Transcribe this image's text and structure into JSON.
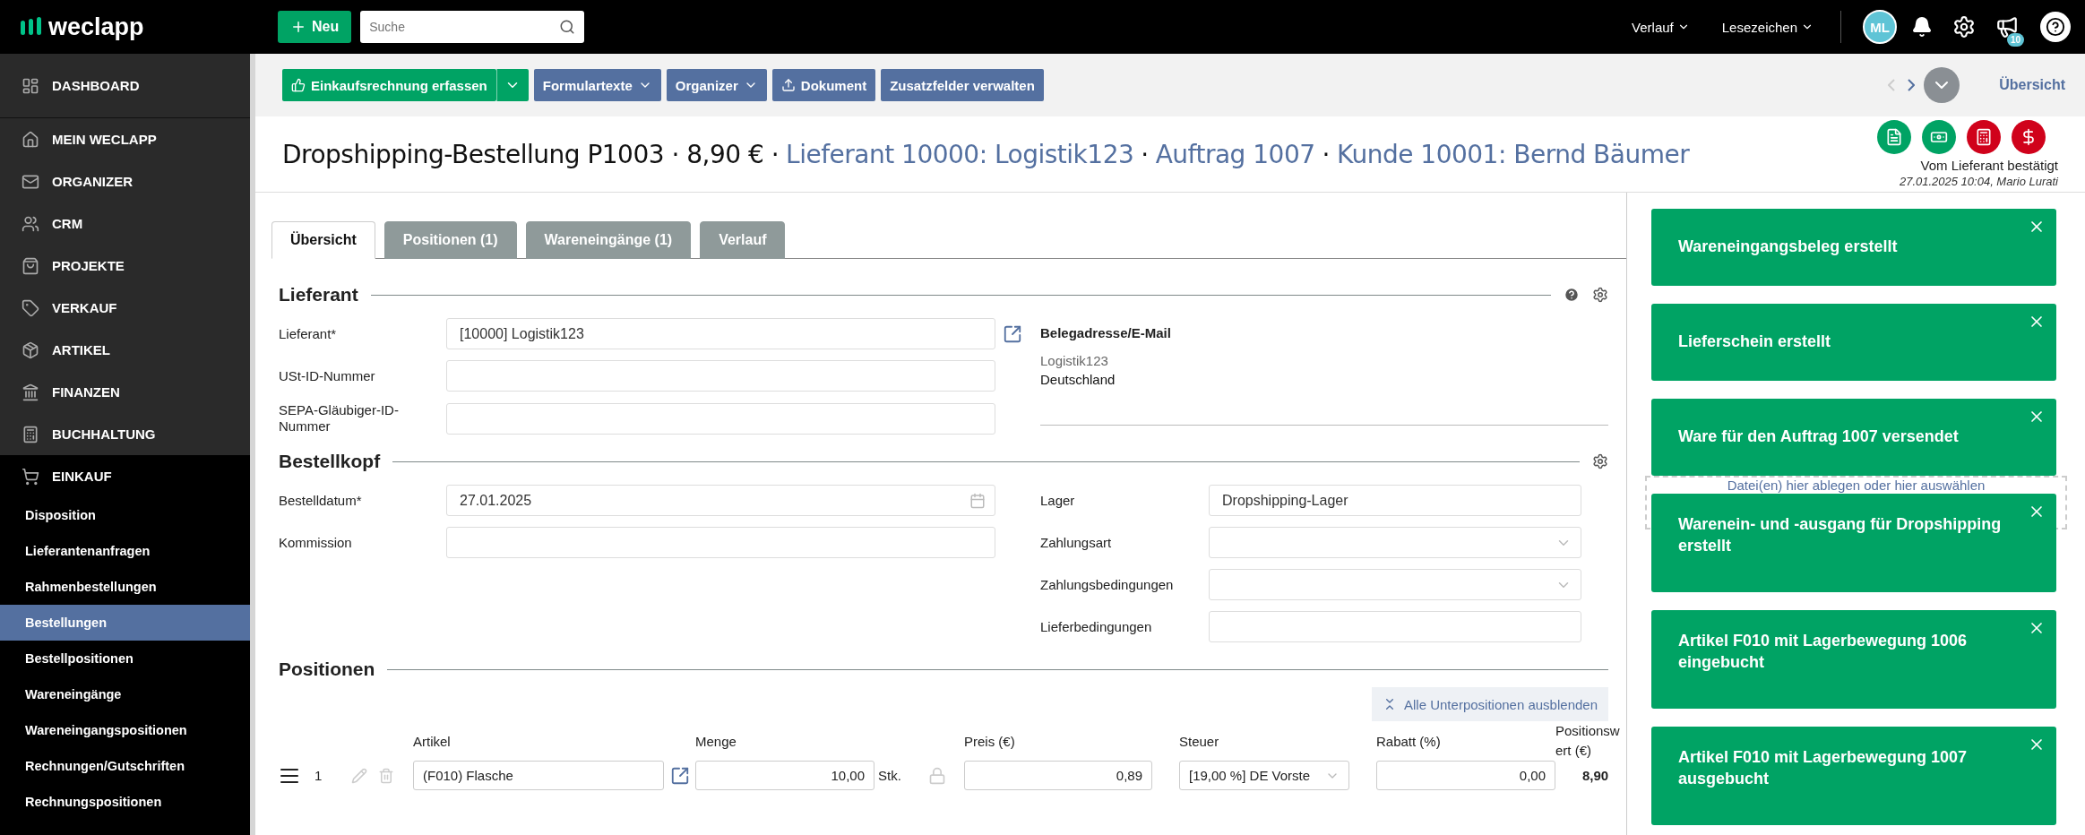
{
  "topbar": {
    "logo": "weclapp",
    "new_button": "Neu",
    "search": {
      "placeholder": "Suche"
    },
    "menus": [
      "Verlauf",
      "Lesezeichen"
    ],
    "avatar": "ML",
    "announcement_badge": "10"
  },
  "sidebar": {
    "main_items": [
      {
        "label": "DASHBOARD",
        "kind": "dashboard",
        "selected": false
      },
      {
        "label": "MEIN WECLAPP",
        "kind": "home",
        "selected": false
      },
      {
        "label": "ORGANIZER",
        "kind": "mail",
        "selected": false
      },
      {
        "label": "CRM",
        "kind": "users",
        "selected": false
      },
      {
        "label": "PROJEKTE",
        "kind": "bag",
        "selected": false
      },
      {
        "label": "VERKAUF",
        "kind": "tag",
        "selected": false
      },
      {
        "label": "ARTIKEL",
        "kind": "box",
        "selected": false
      },
      {
        "label": "FINANZEN",
        "kind": "bank",
        "selected": false
      },
      {
        "label": "BUCHHALTUNG",
        "kind": "calc",
        "selected": false
      }
    ],
    "open_group": {
      "label": "EINKAUF",
      "children": [
        {
          "label": "Disposition",
          "selected": false
        },
        {
          "label": "Lieferantenanfragen",
          "selected": false
        },
        {
          "label": "Rahmenbestellungen",
          "selected": false
        },
        {
          "label": "Bestellungen",
          "selected": true
        },
        {
          "label": "Bestellpositionen",
          "selected": false
        },
        {
          "label": "Wareneingänge",
          "selected": false
        },
        {
          "label": "Wareneingangspositionen",
          "selected": false
        },
        {
          "label": "Rechnungen/Gutschriften",
          "selected": false
        },
        {
          "label": "Rechnungspositionen",
          "selected": false
        }
      ]
    }
  },
  "actions": [
    {
      "label": "Einkaufsrechnung erfassen",
      "kind": "primary"
    },
    {
      "label": "Formulartexte",
      "kind": "menu"
    },
    {
      "label": "Organizer",
      "kind": "menu"
    },
    {
      "label": "Dokument",
      "kind": "upload"
    },
    {
      "label": "Zusatzfelder verwalten",
      "kind": "plain"
    }
  ],
  "record_nav": {
    "prev_disabled": true,
    "next_disabled": false,
    "link": "Übersicht"
  },
  "title": [
    {
      "text": "Dropshipping-Bestellung P1003 · 8,90 € ·",
      "kind": "plain"
    },
    {
      "text": "Lieferant 10000: Logistik123",
      "kind": "link"
    },
    {
      "text": "·",
      "kind": "plain"
    },
    {
      "text": "Auftrag 1007",
      "kind": "link"
    },
    {
      "text": "·",
      "kind": "plain"
    },
    {
      "text": "Kunde 10001: Bernd Bäumer",
      "kind": "link"
    }
  ],
  "status": {
    "icons": [
      {
        "kind": "document",
        "color": "#00a364"
      },
      {
        "kind": "money",
        "color": "#00a364"
      },
      {
        "kind": "calculator",
        "color": "#d0021b"
      },
      {
        "kind": "dollar",
        "color": "#d0021b"
      }
    ],
    "label": "Vom Lieferant bestätigt",
    "meta": "27.01.2025 10:04, Mario Lurati"
  },
  "tabs": [
    {
      "label": "Übersicht",
      "selected": true
    },
    {
      "label": "Positionen (1)",
      "selected": false
    },
    {
      "label": "Wareneingänge (1)",
      "selected": false
    },
    {
      "label": "Verlauf",
      "selected": false
    }
  ],
  "lieferant": {
    "title": "Lieferant",
    "fields": [
      {
        "label": "Lieferant*",
        "value": "[10000] Logistik123",
        "kind": "link"
      },
      {
        "label": "USt-ID-Nummer",
        "kind": "text"
      },
      {
        "label": "SEPA-Gläubiger-ID-Nummer",
        "kind": "text"
      }
    ],
    "address_title": "Belegadresse/E-Mail",
    "address_lines": [
      "Logistik123",
      "Deutschland"
    ]
  },
  "bestellkopf": {
    "title": "Bestellkopf",
    "left": [
      {
        "label": "Bestelldatum*",
        "value": "27.01.2025",
        "kind": "date"
      },
      {
        "label": "Kommission",
        "kind": "text"
      }
    ],
    "right": [
      {
        "label": "Lager",
        "value": "Dropshipping-Lager",
        "kind": "text"
      },
      {
        "label": "Zahlungsart",
        "kind": "select"
      },
      {
        "label": "Zahlungsbedingungen",
        "kind": "select"
      },
      {
        "label": "Lieferbedingungen",
        "kind": "text"
      }
    ]
  },
  "positionen": {
    "title": "Positionen",
    "collapse_button": "Alle Unterpositionen ausblenden",
    "columns": [
      "Artikel",
      "Menge",
      "Preis (€)",
      "Steuer",
      "Rabatt (%)",
      "Positionswert (€)"
    ],
    "rows": [
      {
        "index": "1",
        "artikel": "(F010) Flasche",
        "menge": "10,00",
        "unit": "Stk.",
        "preis": "0,89",
        "steuer": "[19,00 %] DE Vorste",
        "rabatt": "0,00",
        "wert": "8,90"
      }
    ]
  },
  "side_panel": {
    "dropzone": "Datei(en) hier ablegen oder hier auswählen"
  },
  "toasts": [
    "Wareneingangsbeleg erstellt",
    "Lieferschein erstellt",
    "Ware für den Auftrag 1007 versendet",
    "Warenein- und -ausgang für Dropshipping erstellt",
    "Artikel F010 mit Lagerbewegung 1006 eingebucht",
    "Artikel F010 mit Lagerbewegung 1007 ausgebucht"
  ]
}
